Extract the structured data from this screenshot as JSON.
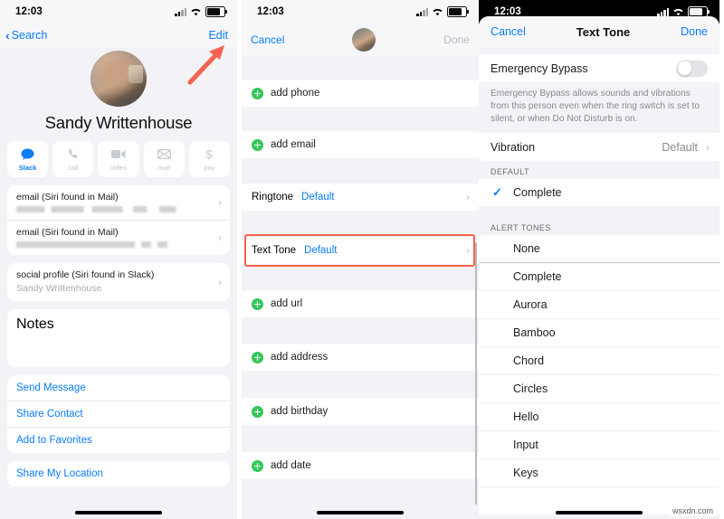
{
  "status_bar": {
    "time": "12:03",
    "signal_icon": "cellular-signal-icon",
    "wifi_icon": "wifi-icon",
    "battery_icon": "battery-icon"
  },
  "colors": {
    "accent_blue": "#0a7cff",
    "green_add": "#34c759",
    "annotation_red": "#f4634f",
    "gray_bg": "#f2f2f7"
  },
  "panel1": {
    "name": "contact-detail-screen",
    "nav": {
      "back_label": "Search",
      "back_icon": "chevron-left-icon",
      "edit_label": "Edit"
    },
    "contact_name": "Sandy Writtenhouse",
    "avatar_alt": "contact-photo",
    "actions": [
      {
        "label": "Slack",
        "icon": "message-bubble-icon",
        "active": true
      },
      {
        "label": "call",
        "icon": "phone-icon",
        "active": false
      },
      {
        "label": "video",
        "icon": "video-camera-icon",
        "active": false
      },
      {
        "label": "mail",
        "icon": "envelope-icon",
        "active": false
      },
      {
        "label": "pay",
        "icon": "dollar-sign-icon",
        "active": false
      }
    ],
    "fields": [
      {
        "label": "email (Siri found in Mail)",
        "value": "",
        "redacted": true
      },
      {
        "label": "email (Siri found in Mail)",
        "value": "",
        "redacted": true
      }
    ],
    "social": {
      "label": "social profile (Siri found in Slack)",
      "value": "Sandy Writtenhouse"
    },
    "notes_label": "Notes",
    "links": [
      "Send Message",
      "Share Contact",
      "Add to Favorites"
    ],
    "link_last": "Share My Location",
    "annotation": {
      "type": "arrow",
      "points_to": "Edit",
      "color": "#f4634f"
    }
  },
  "panel2": {
    "name": "edit-contact-screen",
    "nav": {
      "cancel_label": "Cancel",
      "done_label": "Done",
      "avatar_alt": "contact-photo-small"
    },
    "add_rows_top": [
      "add phone",
      "add email"
    ],
    "ringtone": {
      "label": "Ringtone",
      "value": "Default"
    },
    "text_tone": {
      "label": "Text Tone",
      "value": "Default",
      "highlighted": true
    },
    "add_rows_bottom": [
      "add url",
      "add address",
      "add birthday",
      "add date"
    ]
  },
  "panel3": {
    "name": "text-tone-sheet",
    "nav": {
      "cancel_label": "Cancel",
      "title": "Text Tone",
      "done_label": "Done"
    },
    "emergency_bypass": {
      "label": "Emergency Bypass",
      "enabled": false
    },
    "footnote": "Emergency Bypass allows sounds and vibrations from this person even when the ring switch is set to silent, or when Do Not Disturb is on.",
    "vibration": {
      "label": "Vibration",
      "value": "Default"
    },
    "default_section": {
      "header": "DEFAULT",
      "items": [
        {
          "label": "Complete",
          "selected": true
        }
      ]
    },
    "alert_section": {
      "header": "ALERT TONES",
      "items": [
        {
          "label": "None",
          "selected": false
        },
        {
          "label": "Complete",
          "selected": false
        },
        {
          "label": "Aurora",
          "selected": false
        },
        {
          "label": "Bamboo",
          "selected": false
        },
        {
          "label": "Chord",
          "selected": false
        },
        {
          "label": "Circles",
          "selected": false
        },
        {
          "label": "Hello",
          "selected": false
        },
        {
          "label": "Input",
          "selected": false
        },
        {
          "label": "Keys",
          "selected": false
        }
      ]
    }
  },
  "watermark": "wsxdn.com"
}
